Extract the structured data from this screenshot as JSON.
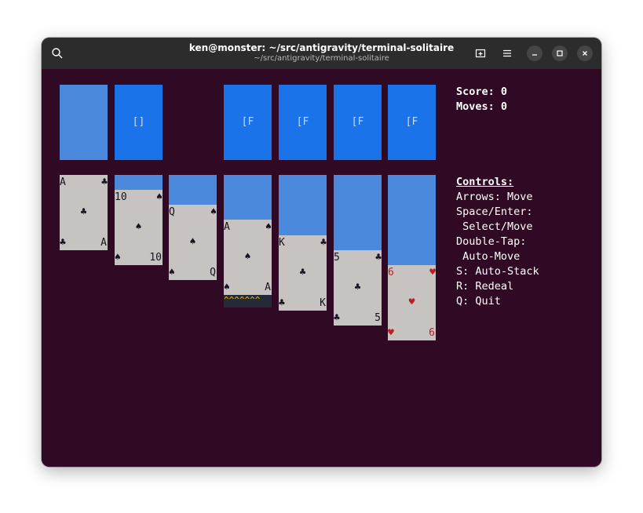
{
  "window": {
    "title": "ken@monster: ~/src/antigravity/terminal-solitaire",
    "subtitle": "~/src/antigravity/terminal-solitaire"
  },
  "colors": {
    "terminal_bg": "#300a24",
    "titlebar_bg": "#2c2c2c",
    "stock": "#4a89dc",
    "foundation": "#1a73e8",
    "card_face": "#c6c3c0",
    "card_back": "#4a89dc",
    "cursor": "#f5c211",
    "red_suit": "#c01c28",
    "black_suit": "#171421"
  },
  "icons": {
    "search": "search-icon",
    "new_tab": "new-tab-icon",
    "menu": "hamburger-menu-icon",
    "minimize": "minimize-icon",
    "maximize": "maximize-icon",
    "close": "close-icon"
  },
  "top_row": {
    "stock": "",
    "waste": "[]",
    "foundations": [
      "[F",
      "[F",
      "[F",
      "[F"
    ]
  },
  "tableau": [
    {
      "rank": "A",
      "suit": "♣",
      "color": "black"
    },
    {
      "rank": "10",
      "suit": "♠",
      "color": "black"
    },
    {
      "rank": "Q",
      "suit": "♠",
      "color": "black"
    },
    {
      "rank": "A",
      "suit": "♠",
      "color": "black"
    },
    {
      "rank": "K",
      "suit": "♣",
      "color": "black"
    },
    {
      "rank": "5",
      "suit": "♣",
      "color": "black"
    },
    {
      "rank": "6",
      "suit": "♥",
      "color": "red"
    }
  ],
  "cursor_marker": "^^^^^^^",
  "stats": {
    "score": "Score: 0",
    "moves": "Moves: 0"
  },
  "controls": {
    "heading": "Controls:",
    "lines": [
      "Arrows: Move",
      "Space/Enter:",
      " Select/Move",
      "Double-Tap:",
      " Auto-Move",
      "S: Auto-Stack",
      "R: Redeal",
      "Q: Quit"
    ]
  }
}
